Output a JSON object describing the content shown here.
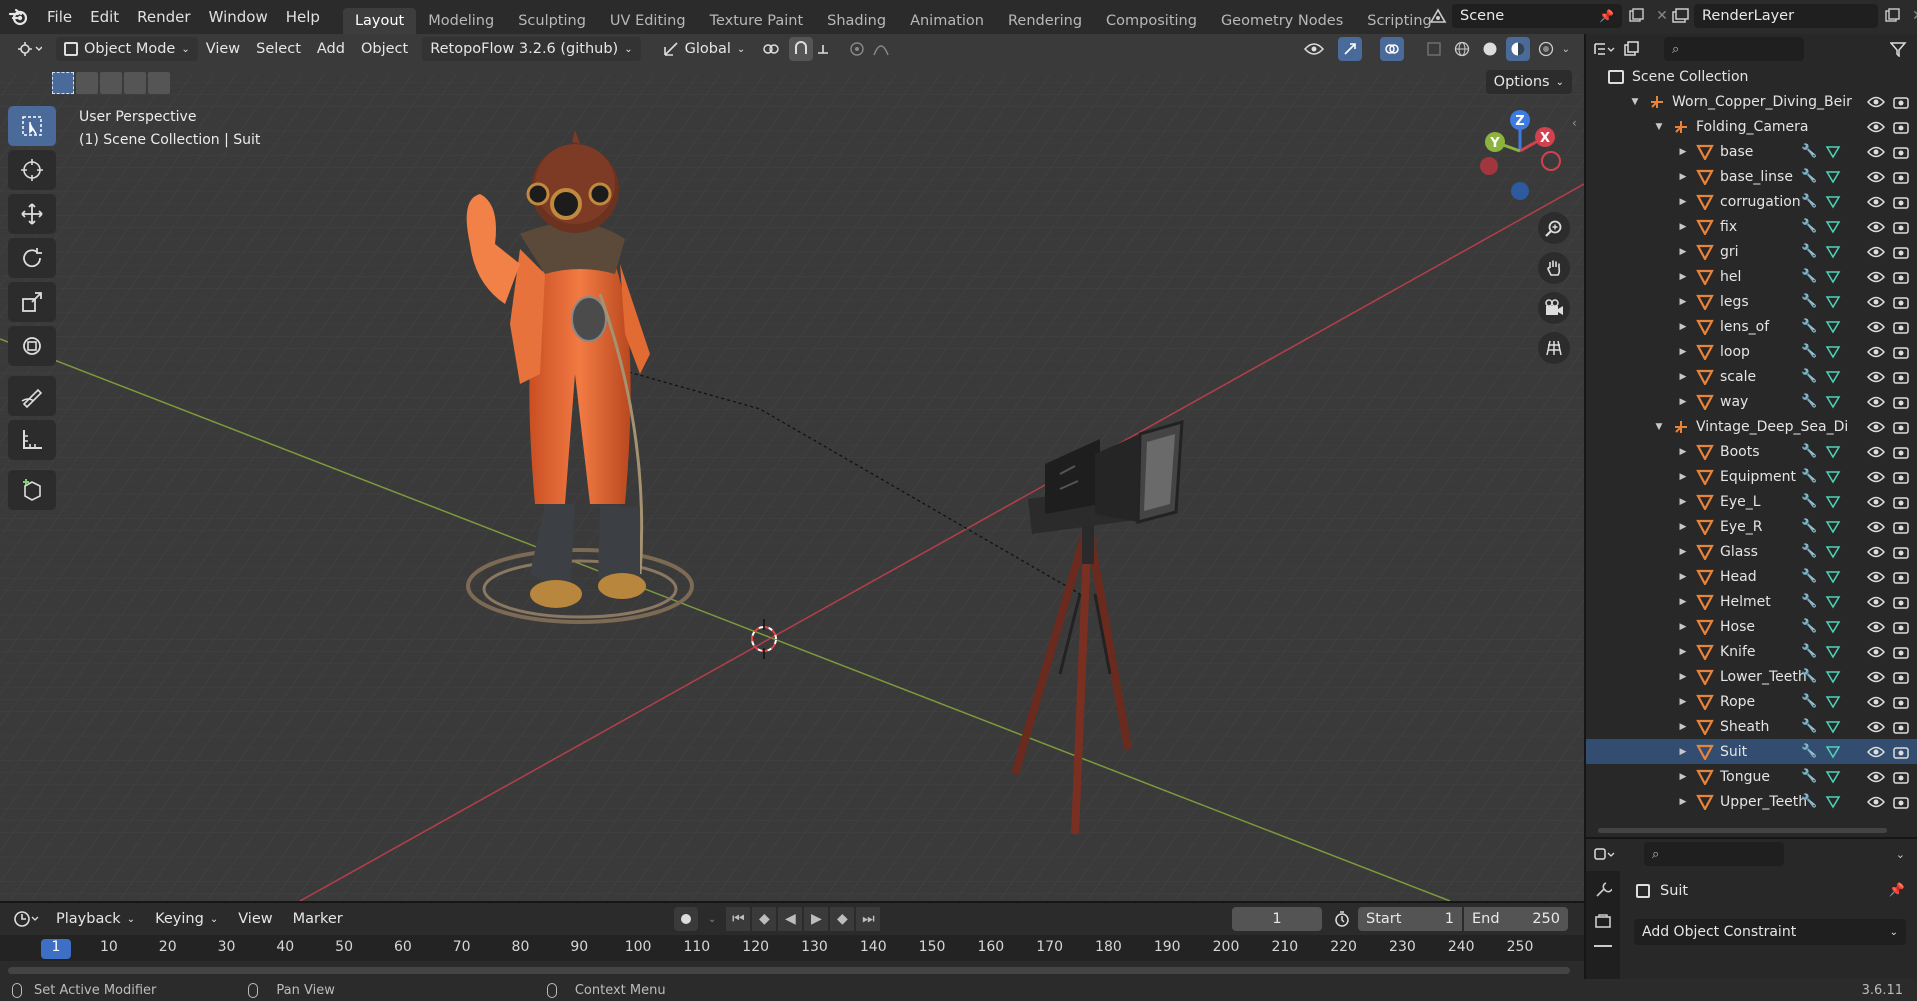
{
  "menubar": {
    "items": [
      "File",
      "Edit",
      "Render",
      "Window",
      "Help"
    ],
    "workspaces": [
      "Layout",
      "Modeling",
      "Sculpting",
      "UV Editing",
      "Texture Paint",
      "Shading",
      "Animation",
      "Rendering",
      "Compositing",
      "Geometry Nodes",
      "Scripting"
    ],
    "active_workspace": "Layout",
    "add_tab": "+",
    "scene": "Scene",
    "view_layer": "RenderLayer"
  },
  "viewport_header": {
    "mode": "Object Mode",
    "menus": [
      "View",
      "Select",
      "Add",
      "Object"
    ],
    "addon": "RetopoFlow 3.2.6 (github)",
    "orientation": "Global",
    "options": "Options"
  },
  "viewport": {
    "perspective": "User Perspective",
    "collection_info": "(1) Scene Collection | Suit",
    "gizmo": {
      "x": "X",
      "y": "Y",
      "z": "Z"
    }
  },
  "outliner": {
    "root": "Scene Collection",
    "rows": [
      {
        "name": "Worn_Copper_Diving_Beir",
        "depth": 0,
        "kind": "empty",
        "expanded": true
      },
      {
        "name": "Folding_Camera",
        "depth": 1,
        "kind": "empty",
        "expanded": true
      },
      {
        "name": "base",
        "depth": 2,
        "kind": "mesh"
      },
      {
        "name": "base_linse",
        "depth": 2,
        "kind": "mesh"
      },
      {
        "name": "corrugation",
        "depth": 2,
        "kind": "mesh"
      },
      {
        "name": "fix",
        "depth": 2,
        "kind": "mesh"
      },
      {
        "name": "gri",
        "depth": 2,
        "kind": "mesh"
      },
      {
        "name": "hel",
        "depth": 2,
        "kind": "mesh"
      },
      {
        "name": "legs",
        "depth": 2,
        "kind": "mesh"
      },
      {
        "name": "lens_of",
        "depth": 2,
        "kind": "mesh"
      },
      {
        "name": "loop",
        "depth": 2,
        "kind": "mesh"
      },
      {
        "name": "scale",
        "depth": 2,
        "kind": "mesh"
      },
      {
        "name": "way",
        "depth": 2,
        "kind": "mesh"
      },
      {
        "name": "Vintage_Deep_Sea_Di",
        "depth": 1,
        "kind": "empty",
        "expanded": true
      },
      {
        "name": "Boots",
        "depth": 2,
        "kind": "mesh"
      },
      {
        "name": "Equipment",
        "depth": 2,
        "kind": "mesh"
      },
      {
        "name": "Eye_L",
        "depth": 2,
        "kind": "mesh"
      },
      {
        "name": "Eye_R",
        "depth": 2,
        "kind": "mesh"
      },
      {
        "name": "Glass",
        "depth": 2,
        "kind": "mesh"
      },
      {
        "name": "Head",
        "depth": 2,
        "kind": "mesh"
      },
      {
        "name": "Helmet",
        "depth": 2,
        "kind": "mesh"
      },
      {
        "name": "Hose",
        "depth": 2,
        "kind": "mesh"
      },
      {
        "name": "Knife",
        "depth": 2,
        "kind": "mesh"
      },
      {
        "name": "Lower_Teeth",
        "depth": 2,
        "kind": "mesh"
      },
      {
        "name": "Rope",
        "depth": 2,
        "kind": "mesh"
      },
      {
        "name": "Sheath",
        "depth": 2,
        "kind": "mesh"
      },
      {
        "name": "Suit",
        "depth": 2,
        "kind": "mesh",
        "selected": true
      },
      {
        "name": "Tongue",
        "depth": 2,
        "kind": "mesh"
      },
      {
        "name": "Upper_Teeth",
        "depth": 2,
        "kind": "mesh"
      }
    ]
  },
  "properties": {
    "object_name": "Suit",
    "add_constraint": "Add Object Constraint"
  },
  "timeline": {
    "menus": [
      "Playback",
      "Keying",
      "View",
      "Marker"
    ],
    "current_frame": "1",
    "start_label": "Start",
    "start": "1",
    "end_label": "End",
    "end": "250",
    "ticks": [
      "1",
      "10",
      "20",
      "30",
      "40",
      "50",
      "60",
      "70",
      "80",
      "90",
      "100",
      "110",
      "120",
      "130",
      "140",
      "150",
      "160",
      "170",
      "180",
      "190",
      "200",
      "210",
      "220",
      "230",
      "240",
      "250"
    ]
  },
  "statusbar": {
    "left_action": "Set Active Modifier",
    "middle_action": "Pan View",
    "right_action": "Context Menu",
    "version": "3.6.11"
  },
  "colors": {
    "accent": "#4a6a9a",
    "selection": "#334d70",
    "mesh_icon": "#e8833a",
    "modifier_icon": "#6f9ae0",
    "data_icon": "#4dd3b8",
    "x_axis": "#d2414e",
    "y_axis": "#8cb33d",
    "z_axis": "#3d7be0"
  }
}
